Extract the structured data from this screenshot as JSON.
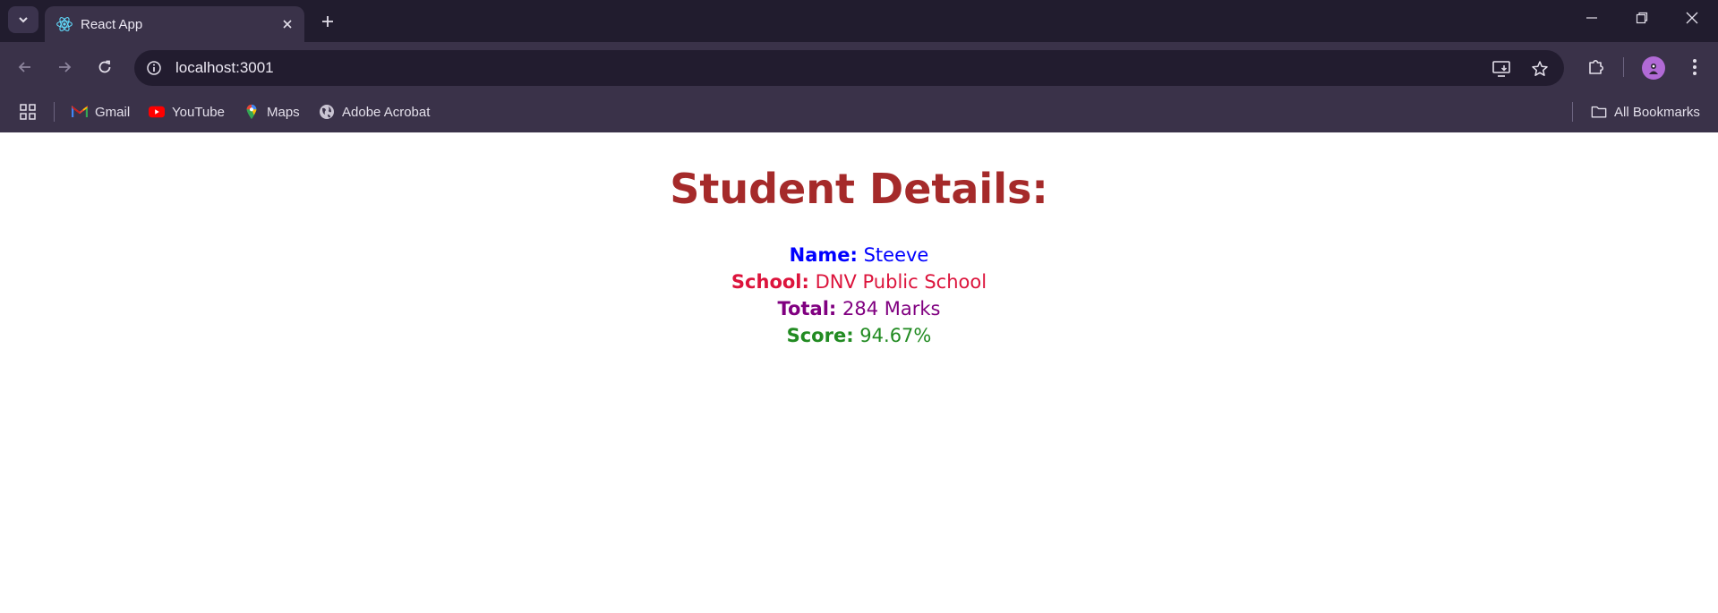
{
  "browser": {
    "tab": {
      "title": "React App"
    },
    "address_bar": {
      "url": "localhost:3001"
    },
    "bookmarks": [
      {
        "label": "Gmail",
        "icon": "gmail-icon"
      },
      {
        "label": "YouTube",
        "icon": "youtube-icon"
      },
      {
        "label": "Maps",
        "icon": "maps-icon"
      },
      {
        "label": "Adobe Acrobat",
        "icon": "globe-icon"
      }
    ],
    "all_bookmarks_label": "All Bookmarks",
    "colors": {
      "titlebar": "#211c2e",
      "toolbar": "#3a3249",
      "omnibox": "#221c2f"
    }
  },
  "page": {
    "heading": "Student Details:",
    "details": [
      {
        "label": "Name:",
        "value": "Steeve",
        "color": "#0000ff"
      },
      {
        "label": "School:",
        "value": "DNV Public School",
        "color": "#dc143c"
      },
      {
        "label": "Total:",
        "value": "284 Marks",
        "color": "#800080"
      },
      {
        "label": "Score:",
        "value": "94.67%",
        "color": "#228b22"
      }
    ],
    "heading_color": "#a52a2a"
  }
}
